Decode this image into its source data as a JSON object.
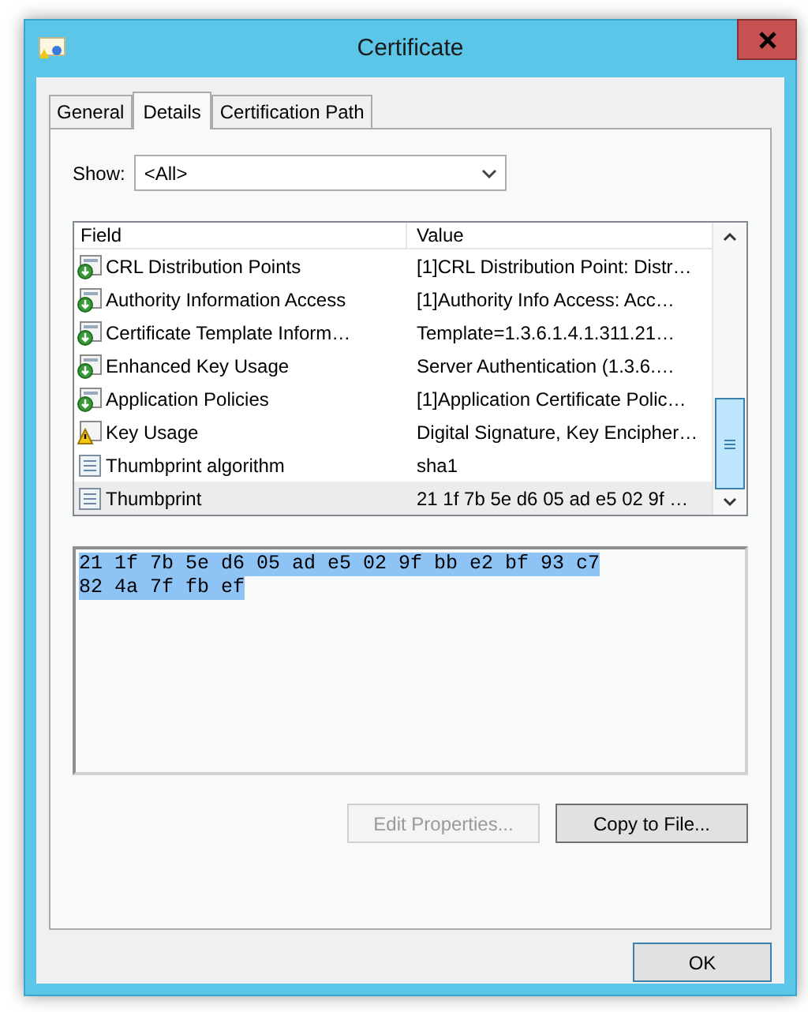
{
  "window": {
    "title": "Certificate"
  },
  "tabs": [
    {
      "label": "General",
      "selected": false
    },
    {
      "label": "Details",
      "selected": true
    },
    {
      "label": "Certification Path",
      "selected": false
    }
  ],
  "show": {
    "label": "Show:",
    "value": "<All>"
  },
  "table": {
    "columns": [
      "Field",
      "Value"
    ],
    "rows": [
      {
        "kind": "extension",
        "field": "CRL Distribution Points",
        "value": "[1]CRL Distribution Point: Distr…",
        "selected": false
      },
      {
        "kind": "extension",
        "field": "Authority Information Access",
        "value": "[1]Authority Info Access: Acc…",
        "selected": false
      },
      {
        "kind": "extension",
        "field": "Certificate Template Inform…",
        "value": "Template=1.3.6.1.4.1.311.21…",
        "selected": false
      },
      {
        "kind": "extension",
        "field": "Enhanced Key Usage",
        "value": "Server Authentication (1.3.6.…",
        "selected": false
      },
      {
        "kind": "extension",
        "field": "Application Policies",
        "value": "[1]Application Certificate Polic…",
        "selected": false
      },
      {
        "kind": "warning",
        "field": "Key Usage",
        "value": "Digital Signature, Key Encipher…",
        "selected": false
      },
      {
        "kind": "property",
        "field": "Thumbprint algorithm",
        "value": "sha1",
        "selected": false
      },
      {
        "kind": "property",
        "field": "Thumbprint",
        "value": "21 1f 7b 5e d6 05 ad e5 02 9f …",
        "selected": true
      }
    ]
  },
  "detail": {
    "lines": [
      "21 1f 7b 5e d6 05 ad e5 02 9f bb e2 bf 93 c7",
      "82 4a 7f fb ef"
    ],
    "selected": true
  },
  "buttons": [
    {
      "label": "Edit Properties...",
      "disabled": true
    },
    {
      "label": "Copy to File...",
      "disabled": false
    }
  ],
  "ok": {
    "label": "OK"
  }
}
